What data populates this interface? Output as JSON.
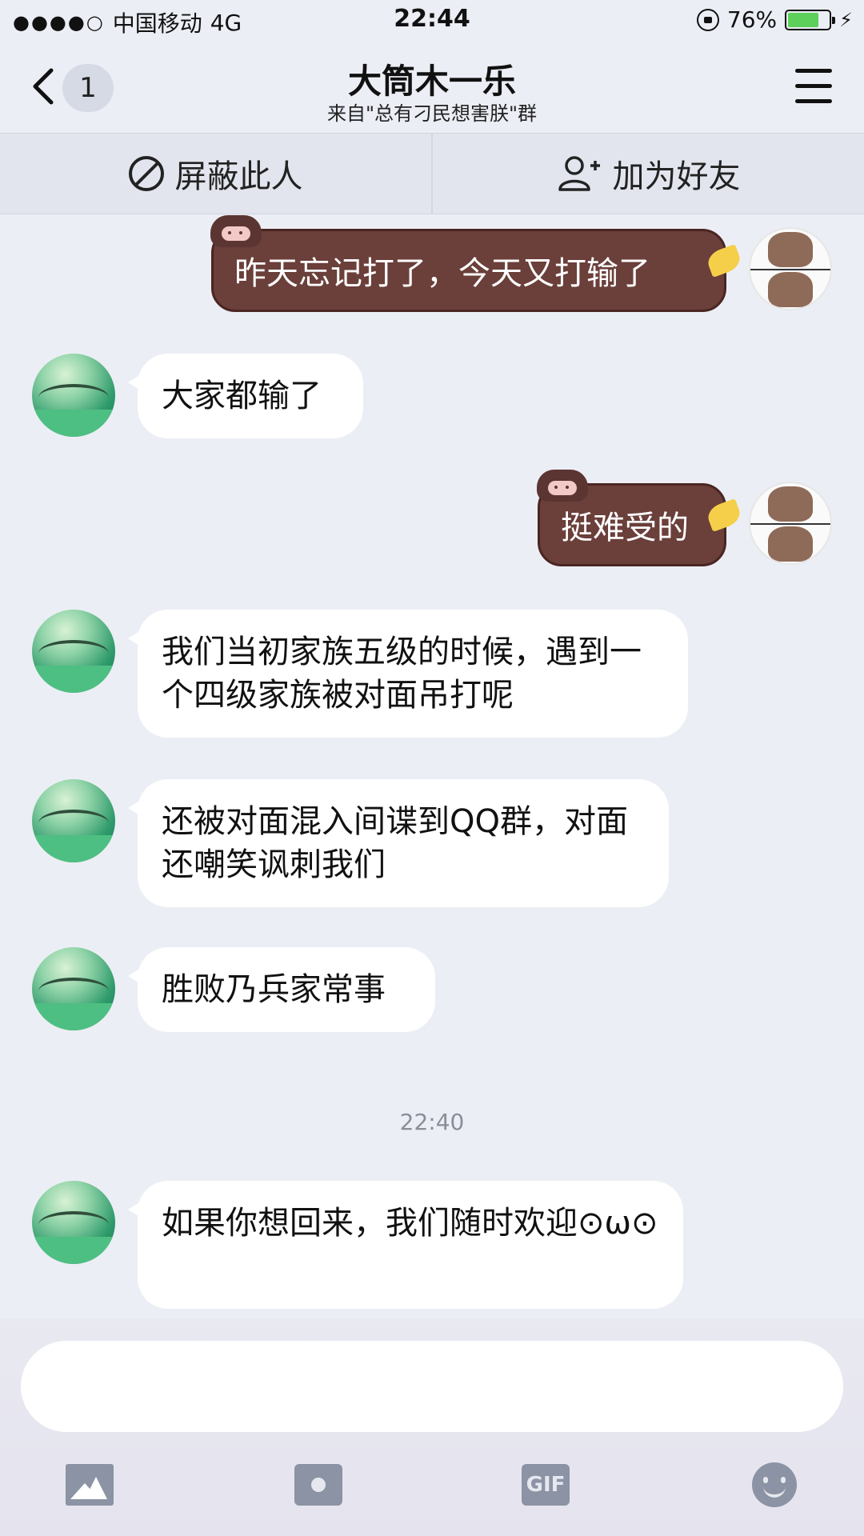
{
  "status_bar": {
    "signal_dots": "●●●●○",
    "carrier": "中国移动",
    "network": "4G",
    "time": "22:44",
    "battery_percent": "76%",
    "battery_level": 0.76,
    "battery_color": "#5cd05a",
    "bolt": "⚡"
  },
  "header": {
    "unread_count": "1",
    "title": "大筒木一乐",
    "subtitle": "来自\"总有刁民想害朕\"群"
  },
  "actions": {
    "block_label": "屏蔽此人",
    "add_friend_label": "加为好友"
  },
  "messages": [
    {
      "side": "right",
      "text": "昨天忘记打了，今天又打输了"
    },
    {
      "side": "left",
      "text": "大家都输了"
    },
    {
      "side": "right",
      "text": "挺难受的"
    },
    {
      "side": "left",
      "text": "我们当初家族五级的时候，遇到一个四级家族被对面吊打呢"
    },
    {
      "side": "left",
      "text": "还被对面混入间谍到QQ群，对面还嘲笑讽刺我们"
    },
    {
      "side": "left",
      "text": "胜败乃兵家常事"
    },
    {
      "side": "left",
      "text": "如果你想回来，我们随时欢迎⊙ω⊙"
    }
  ],
  "timestamp": "22:40",
  "toolbar": {
    "gif_label": "GIF"
  },
  "colors": {
    "accent_bubble_right": "#6b3f3a",
    "background": "#eceef5"
  }
}
